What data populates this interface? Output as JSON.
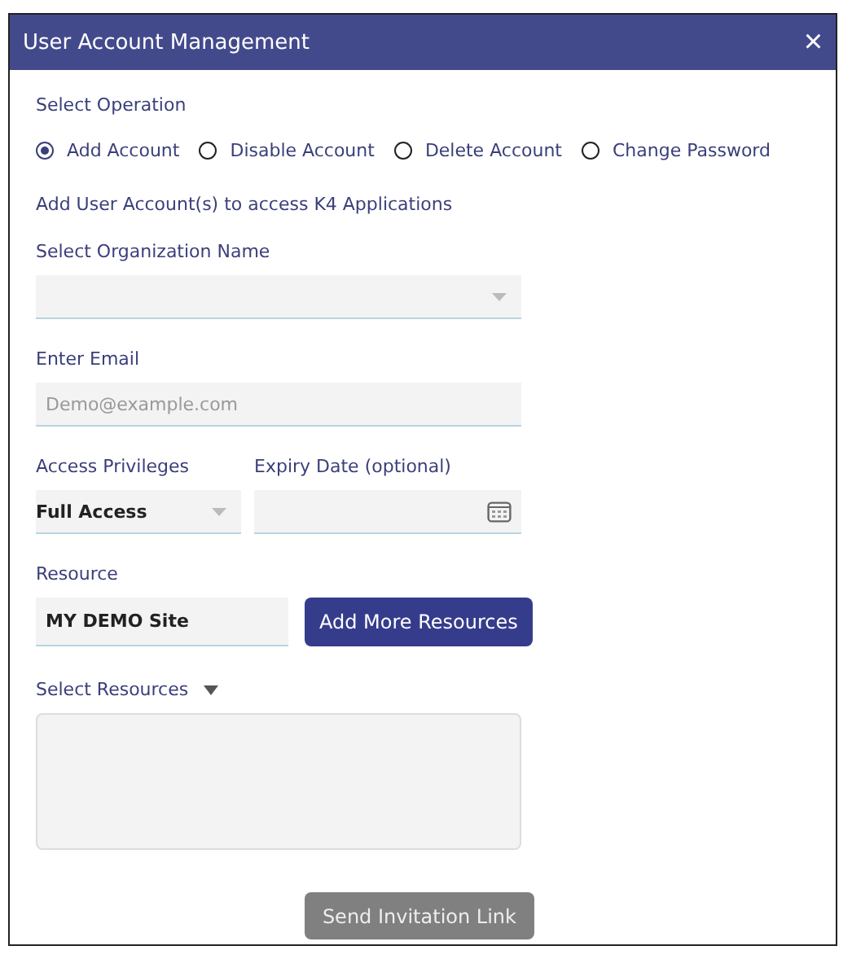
{
  "window": {
    "title": "User Account Management",
    "close": "×"
  },
  "operation": {
    "label": "Select Operation",
    "options": [
      {
        "label": "Add Account",
        "selected": true
      },
      {
        "label": "Disable Account",
        "selected": false
      },
      {
        "label": "Delete Account",
        "selected": false
      },
      {
        "label": "Change Password",
        "selected": false
      }
    ]
  },
  "section_title": "Add User Account(s) to access K4 Applications",
  "organization": {
    "label": "Select Organization Name"
  },
  "email": {
    "label": "Enter Email",
    "placeholder": "Demo@example.com"
  },
  "access": {
    "label": "Access Privileges",
    "value": "Full Access"
  },
  "expiry": {
    "label": "Expiry Date (optional)"
  },
  "resource": {
    "label": "Resource",
    "value": "MY DEMO Site",
    "button": "Add More Resources"
  },
  "select_resources": {
    "label": "Select Resources"
  },
  "send_button": {
    "label": "Send Invitation Link",
    "disabled": true
  }
}
